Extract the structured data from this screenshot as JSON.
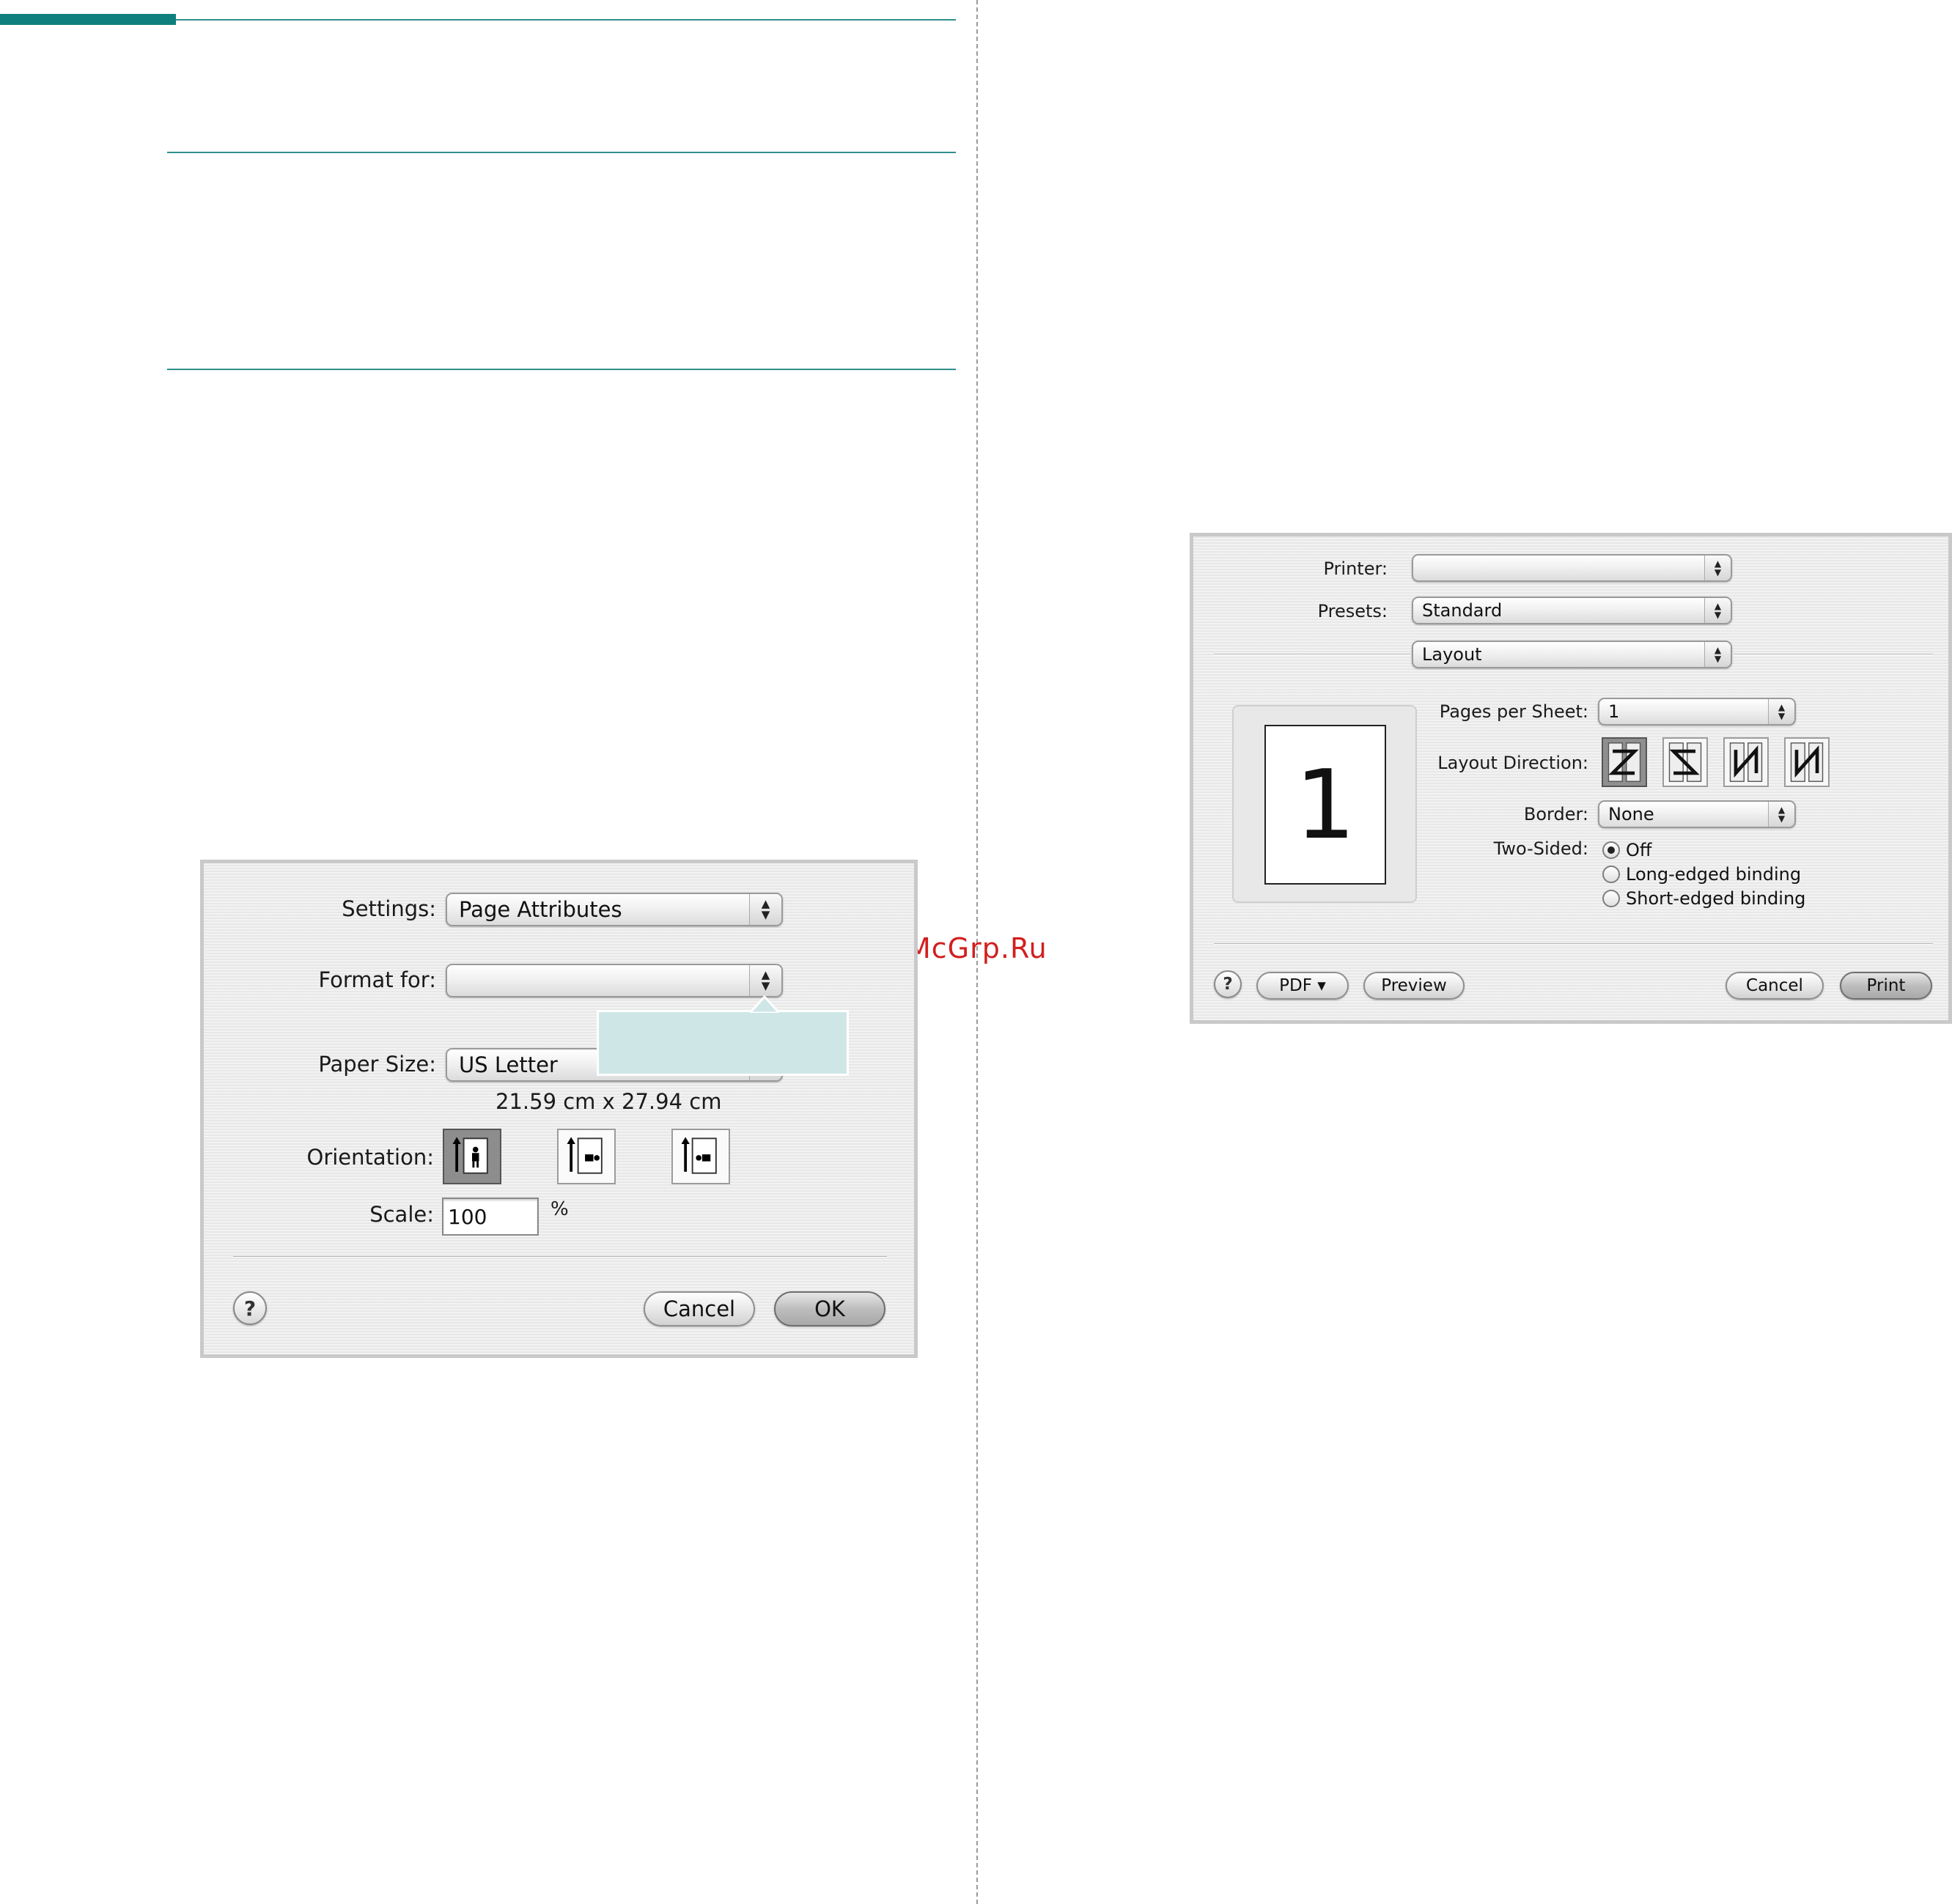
{
  "watermark": "McGrp.Ru",
  "page_setup_dialog": {
    "settings_label": "Settings:",
    "settings_value": "Page Attributes",
    "format_for_label": "Format for:",
    "format_for_value": "",
    "paper_size_label": "Paper Size:",
    "paper_size_value": "US Letter",
    "paper_dimensions": "21.59 cm x 27.94 cm",
    "orientation_label": "Orientation:",
    "orientation_options": [
      "portrait",
      "landscape-left",
      "landscape-right"
    ],
    "orientation_selected": "portrait",
    "scale_label": "Scale:",
    "scale_value": "100",
    "scale_unit": "%",
    "help_label": "?",
    "cancel_label": "Cancel",
    "ok_label": "OK"
  },
  "print_dialog": {
    "printer_label": "Printer:",
    "printer_value": "",
    "presets_label": "Presets:",
    "presets_value": "Standard",
    "panel_value": "Layout",
    "pages_per_sheet_label": "Pages per Sheet:",
    "pages_per_sheet_value": "1",
    "layout_direction_label": "Layout Direction:",
    "layout_direction_selected": 0,
    "border_label": "Border:",
    "border_value": "None",
    "two_sided_label": "Two-Sided:",
    "two_sided_options": [
      "Off",
      "Long-edged binding",
      "Short-edged binding"
    ],
    "two_sided_selected": "Off",
    "preview_page_number": "1",
    "help_label": "?",
    "pdf_label": "PDF ▾",
    "preview_label": "Preview",
    "cancel_label": "Cancel",
    "print_label": "Print"
  },
  "colors": {
    "accent": "#0e7f7c",
    "callout": "#cfe6e6",
    "watermark": "#d21f1f"
  }
}
